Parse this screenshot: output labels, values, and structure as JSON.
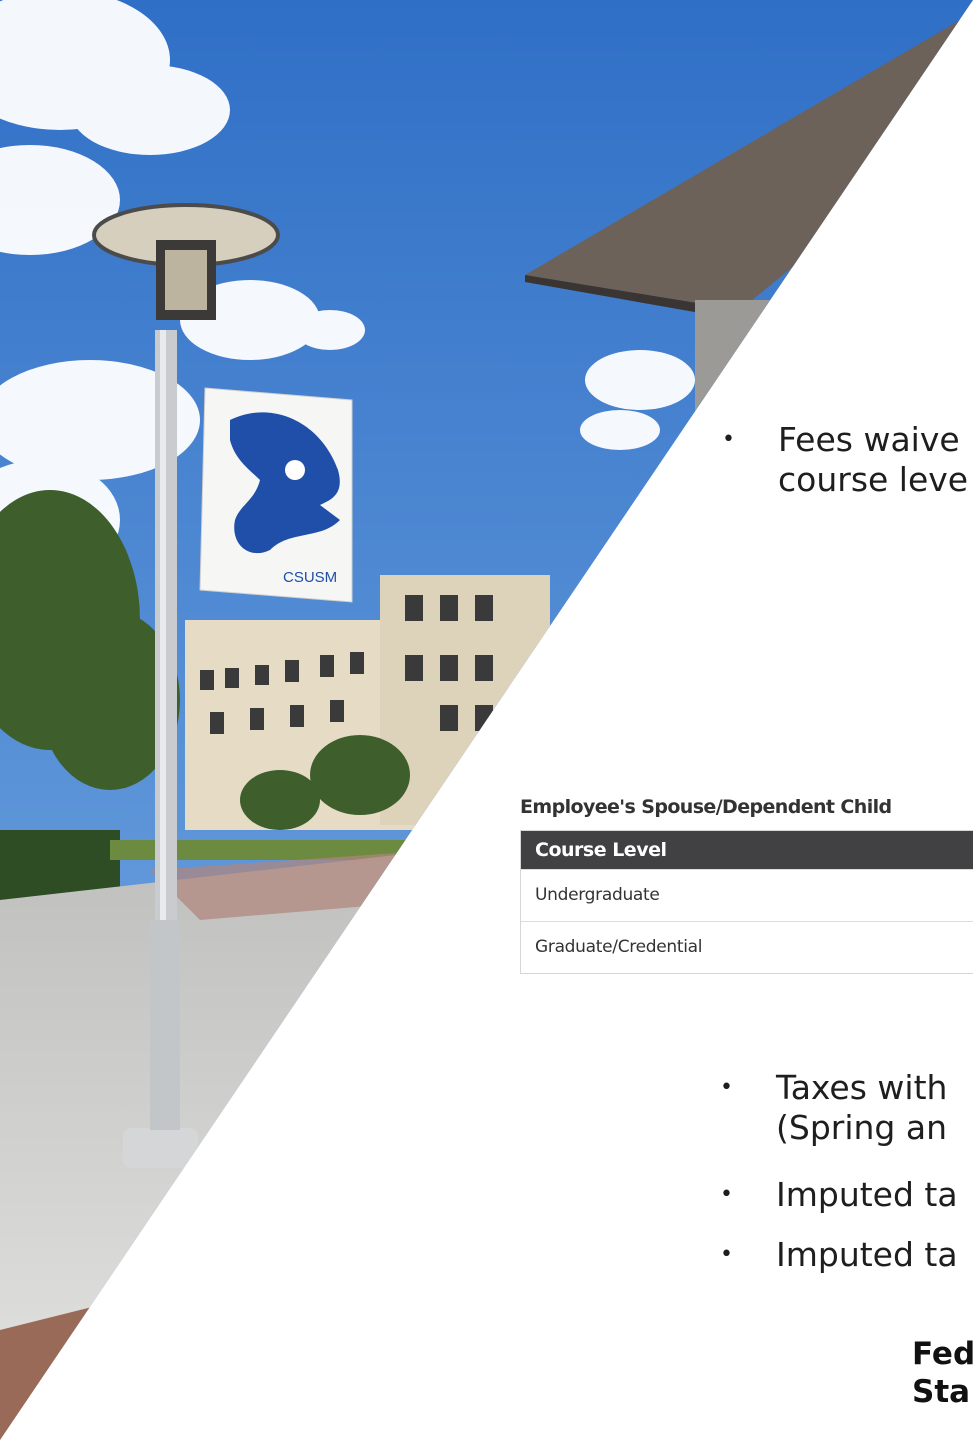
{
  "photo": {
    "banner_text": "CSUSM",
    "sky_color": "#4a86d0"
  },
  "bullets": {
    "fees_waived": [
      "Fees waive",
      "course leve"
    ],
    "taxes_withheld": [
      "Taxes with",
      "(Spring an"
    ],
    "imputed_1": "Imputed ta",
    "imputed_2": "Imputed ta"
  },
  "table": {
    "caption": "Employee's Spouse/Dependent Child",
    "header": "Course Level",
    "rows": [
      "Undergraduate",
      "Graduate/Credential"
    ]
  },
  "footer": {
    "lines": [
      "Fed",
      "Sta"
    ]
  },
  "colors": {
    "table_header_bg": "#414042",
    "banner_logo": "#1f4fa8"
  }
}
